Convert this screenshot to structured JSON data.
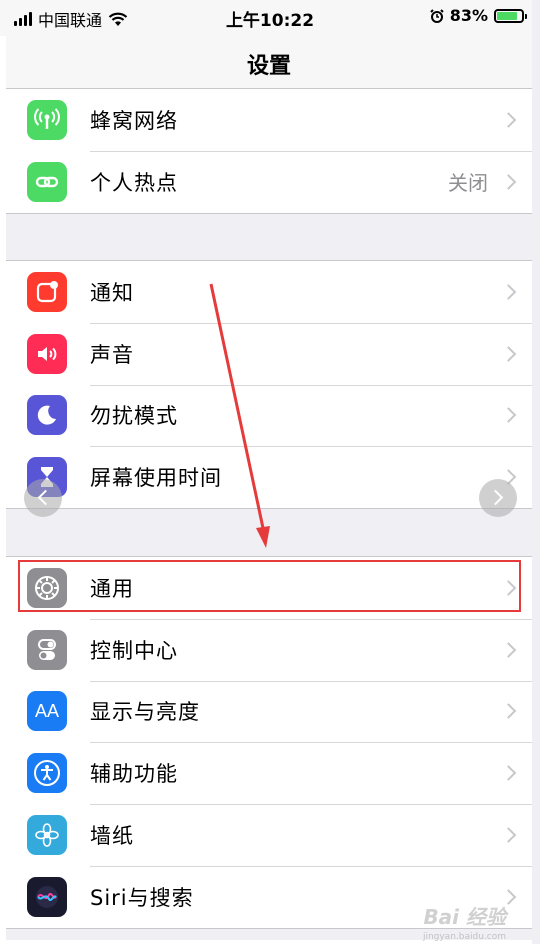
{
  "status_bar": {
    "carrier": "中国联通",
    "time": "上午10:22",
    "battery_percent": "83%",
    "battery_level": 0.83,
    "icons": [
      "signal-icon",
      "wifi-icon",
      "alarm-icon",
      "battery-charging-icon"
    ]
  },
  "nav": {
    "title": "设置"
  },
  "group1": [
    {
      "label": "蜂窝网络",
      "icon": "cellular-icon",
      "color": "#4cd964"
    },
    {
      "label": "个人热点",
      "value": "关闭",
      "icon": "hotspot-icon",
      "color": "#4cd964"
    }
  ],
  "group2": [
    {
      "label": "通知",
      "icon": "notifications-icon",
      "color": "#ff3b30"
    },
    {
      "label": "声音",
      "icon": "sound-icon",
      "color": "#ff2d55"
    },
    {
      "label": "勿扰模式",
      "icon": "moon-icon",
      "color": "#5856d6"
    },
    {
      "label": "屏幕使用时间",
      "icon": "hourglass-icon",
      "color": "#5856d6"
    }
  ],
  "group3": [
    {
      "label": "通用",
      "icon": "gear-icon",
      "color": "#8e8e93"
    },
    {
      "label": "控制中心",
      "icon": "toggles-icon",
      "color": "#8e8e93"
    },
    {
      "label": "显示与亮度",
      "icon": "display-aa-icon",
      "icon_text": "AA",
      "color": "#1a7cf5"
    },
    {
      "label": "辅助功能",
      "icon": "accessibility-icon",
      "color": "#1a7cf5"
    },
    {
      "label": "墙纸",
      "icon": "wallpaper-flower-icon",
      "color": "#34aadc"
    },
    {
      "label": "Siri与搜索",
      "icon": "siri-icon",
      "color": "#1a1a2e"
    }
  ],
  "annotation": {
    "arrow_color": "#e63b3b",
    "highlight_color": "#e63b3b"
  },
  "watermark": {
    "text": "Bai 经验",
    "sub": "jingyan.baidu.com"
  }
}
